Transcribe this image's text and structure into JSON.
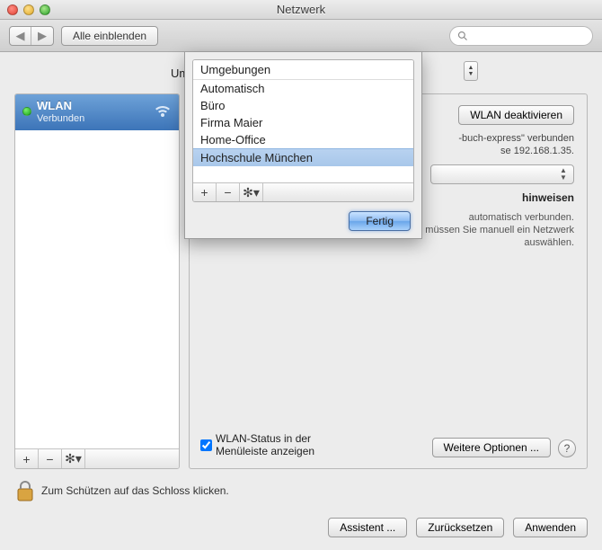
{
  "window": {
    "title": "Netzwerk"
  },
  "toolbar": {
    "show_all_label": "Alle einblenden",
    "search_placeholder": ""
  },
  "umgebung_label_short": "Umg",
  "sidebar": {
    "items": [
      {
        "name": "WLAN",
        "status": "Verbunden"
      }
    ]
  },
  "detail": {
    "deactivate_label": "WLAN deaktivieren",
    "connected_text_1": "-buch-express\" verbunden",
    "connected_text_2": "se 192.168.1.35.",
    "hint_title": "hinweisen",
    "hint_body_1": "automatisch verbunden.",
    "hint_body_2": "rk vorhanden ist, müssen Sie manuell ein Netzwerk auswählen.",
    "status_checkbox_label": "WLAN-Status in der\nMenüleiste anzeigen",
    "more_options_label": "Weitere Optionen ..."
  },
  "popover": {
    "header": "Umgebungen",
    "items": [
      "Automatisch",
      "Büro",
      "Firma Maier",
      "Home-Office",
      "Hochschule München"
    ],
    "selected_index": 4,
    "done_label": "Fertig"
  },
  "lock_text": "Zum Schützen auf das Schloss klicken.",
  "bottom": {
    "assistant": "Assistent ...",
    "revert": "Zurücksetzen",
    "apply": "Anwenden"
  }
}
